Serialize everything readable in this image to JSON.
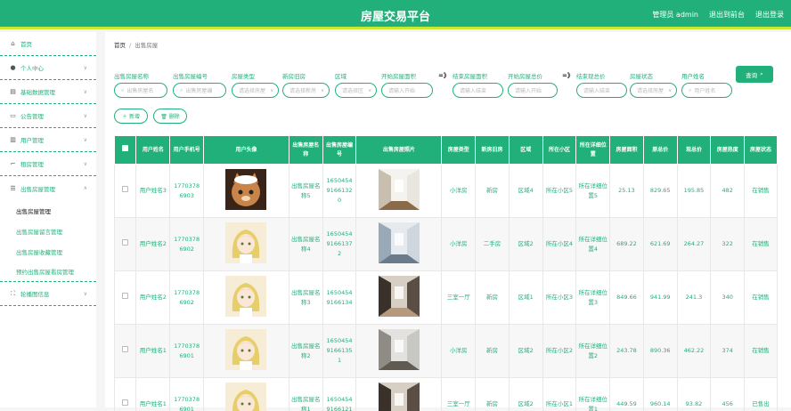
{
  "header": {
    "title": "房屋交易平台",
    "admin": "管理员 admin",
    "to_front": "退出到前台",
    "logout": "退出登录"
  },
  "sidebar": {
    "items": [
      {
        "label": "首页",
        "icon": "home-icon",
        "chevron": false
      },
      {
        "label": "个人中心",
        "icon": "user-icon",
        "chevron": true
      },
      {
        "label": "基础数据管理",
        "icon": "database-icon",
        "chevron": true
      },
      {
        "label": "公告管理",
        "icon": "monitor-icon",
        "chevron": true
      },
      {
        "label": "用户管理",
        "icon": "users-icon",
        "chevron": true
      },
      {
        "label": "租房管理",
        "icon": "crop-icon",
        "chevron": true
      },
      {
        "label": "出售房屋管理",
        "icon": "list-icon",
        "chevron": true
      }
    ],
    "subitems": [
      {
        "label": "出售房屋管理",
        "active": true
      },
      {
        "label": "出售房屋留言管理",
        "active": false
      },
      {
        "label": "出售房屋收藏管理",
        "active": false
      },
      {
        "label": "预约出售房屋看房管理",
        "active": false
      }
    ],
    "last": {
      "label": "轮播图信息",
      "icon": "expand-icon"
    }
  },
  "breadcrumb": {
    "home": "首页",
    "sep": "/",
    "current": "出售房屋"
  },
  "filters": [
    {
      "label": "出售房屋名称",
      "placeholder": "出售房屋名",
      "type": "search"
    },
    {
      "label": "出售房屋编号",
      "placeholder": "出售房屋编",
      "type": "search"
    },
    {
      "label": "房屋类型",
      "placeholder": "请选择房屋",
      "type": "select"
    },
    {
      "label": "新房旧房",
      "placeholder": "请选择新房",
      "type": "select"
    },
    {
      "label": "区域",
      "placeholder": "请选择区",
      "type": "select"
    },
    {
      "label": "开始房屋面积",
      "placeholder": "请输入开始",
      "type": "input"
    },
    {
      "label": "结束房屋面积",
      "placeholder": "请输入结束",
      "type": "input"
    },
    {
      "label": "开始房屋总价",
      "placeholder": "请输入开始",
      "type": "input"
    },
    {
      "label": "结束现总价",
      "placeholder": "请输入结束",
      "type": "input"
    },
    {
      "label": "房屋状态",
      "placeholder": "请选择房屋",
      "type": "select"
    },
    {
      "label": "用户姓名",
      "placeholder": "用户姓名",
      "type": "search"
    }
  ],
  "arrows": [
    "=》",
    "=》"
  ],
  "search_button": "查询",
  "actions": {
    "add": "＋ 新增",
    "delete": "🗑 删除"
  },
  "table": {
    "headers": [
      "用户姓名",
      "用户手机号",
      "用户头像",
      "出售房屋名称",
      "出售房屋编号",
      "出售房屋照片",
      "房屋类型",
      "新房旧房",
      "区域",
      "所在小区",
      "所在详细位置",
      "房屋面积",
      "原总价",
      "现总价",
      "房屋热度",
      "房屋状态"
    ],
    "rows": [
      {
        "name": "用户姓名3",
        "phone": "17703786903",
        "avatar": "cat",
        "house": "出售房屋名称5",
        "code": "16504549166132 0",
        "photo": "room-bright",
        "type": "小洋房",
        "age": "新房",
        "area": "区域4",
        "community": "所在小区5",
        "location": "所在详细位置5",
        "size": "25.13",
        "orig": "829.65",
        "now": "195.85",
        "heat": "482",
        "status": "在销售"
      },
      {
        "name": "用户姓名2",
        "phone": "17703786902",
        "avatar": "anime",
        "house": "出售房屋名称4",
        "code": "16504549166137 2",
        "photo": "room-blue",
        "type": "小洋房",
        "age": "二手房",
        "area": "区域2",
        "community": "所在小区4",
        "location": "所在详细位置4",
        "size": "689.22",
        "orig": "621.69",
        "now": "264.27",
        "heat": "322",
        "status": "在销售"
      },
      {
        "name": "用户姓名2",
        "phone": "17703786902",
        "avatar": "anime",
        "house": "出售房屋名称3",
        "code": "16504549166134",
        "photo": "room-dark",
        "type": "三室一厅",
        "age": "新房",
        "area": "区域1",
        "community": "所在小区3",
        "location": "所在详细位置3",
        "size": "849.66",
        "orig": "941.99",
        "now": "241.3",
        "heat": "340",
        "status": "在销售"
      },
      {
        "name": "用户姓名1",
        "phone": "17703786901",
        "avatar": "anime",
        "house": "出售房屋名称2",
        "code": "16504549166135 1",
        "photo": "room-gray",
        "type": "小洋房",
        "age": "新房",
        "area": "区域2",
        "community": "所在小区2",
        "location": "所在详细位置2",
        "size": "243.78",
        "orig": "890.36",
        "now": "462.22",
        "heat": "374",
        "status": "在销售"
      },
      {
        "name": "用户姓名1",
        "phone": "17703786901",
        "avatar": "anime",
        "house": "出售房屋名称1",
        "code": "16504549166121",
        "photo": "room-dark",
        "type": "三室一厅",
        "age": "新房",
        "area": "区域2",
        "community": "所在小区1",
        "location": "所在详细位置1",
        "size": "449.59",
        "orig": "960.14",
        "now": "93.82",
        "heat": "456",
        "status": "已售出"
      }
    ]
  },
  "colors": {
    "accent": "#22b07a",
    "stripe": "#c8e832"
  }
}
